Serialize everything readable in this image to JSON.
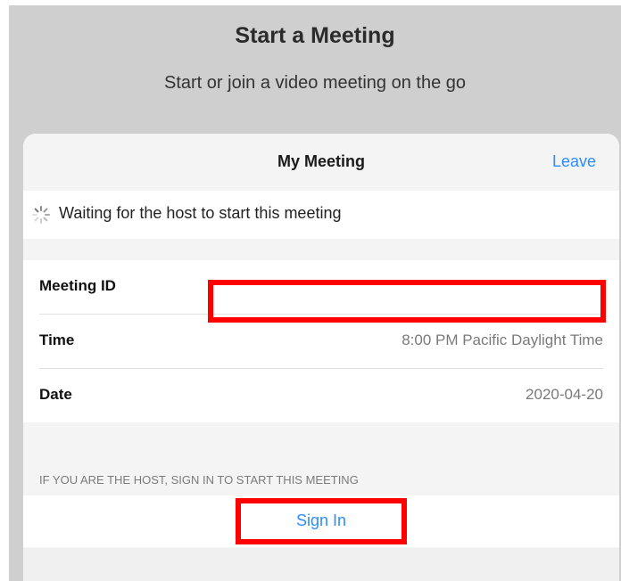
{
  "header": {
    "title": "Start a Meeting",
    "subtitle": "Start or join a video meeting on the go"
  },
  "card": {
    "title": "My Meeting",
    "leave_label": "Leave",
    "status_text": "Waiting for the host to start this meeting"
  },
  "details": {
    "meeting_id_label": "Meeting ID",
    "meeting_id_value": "",
    "time_label": "Time",
    "time_value": "8:00 PM Pacific Daylight Time",
    "date_label": "Date",
    "date_value": "2020-04-20"
  },
  "host_note": "IF YOU ARE THE HOST, SIGN IN TO START THIS MEETING",
  "sign_in_label": "Sign In",
  "colors": {
    "accent": "#2d8cff",
    "highlight": "#ff0000",
    "backdrop": "#cfcfcf"
  },
  "icons": {
    "spinner": "loading-spinner-icon"
  }
}
